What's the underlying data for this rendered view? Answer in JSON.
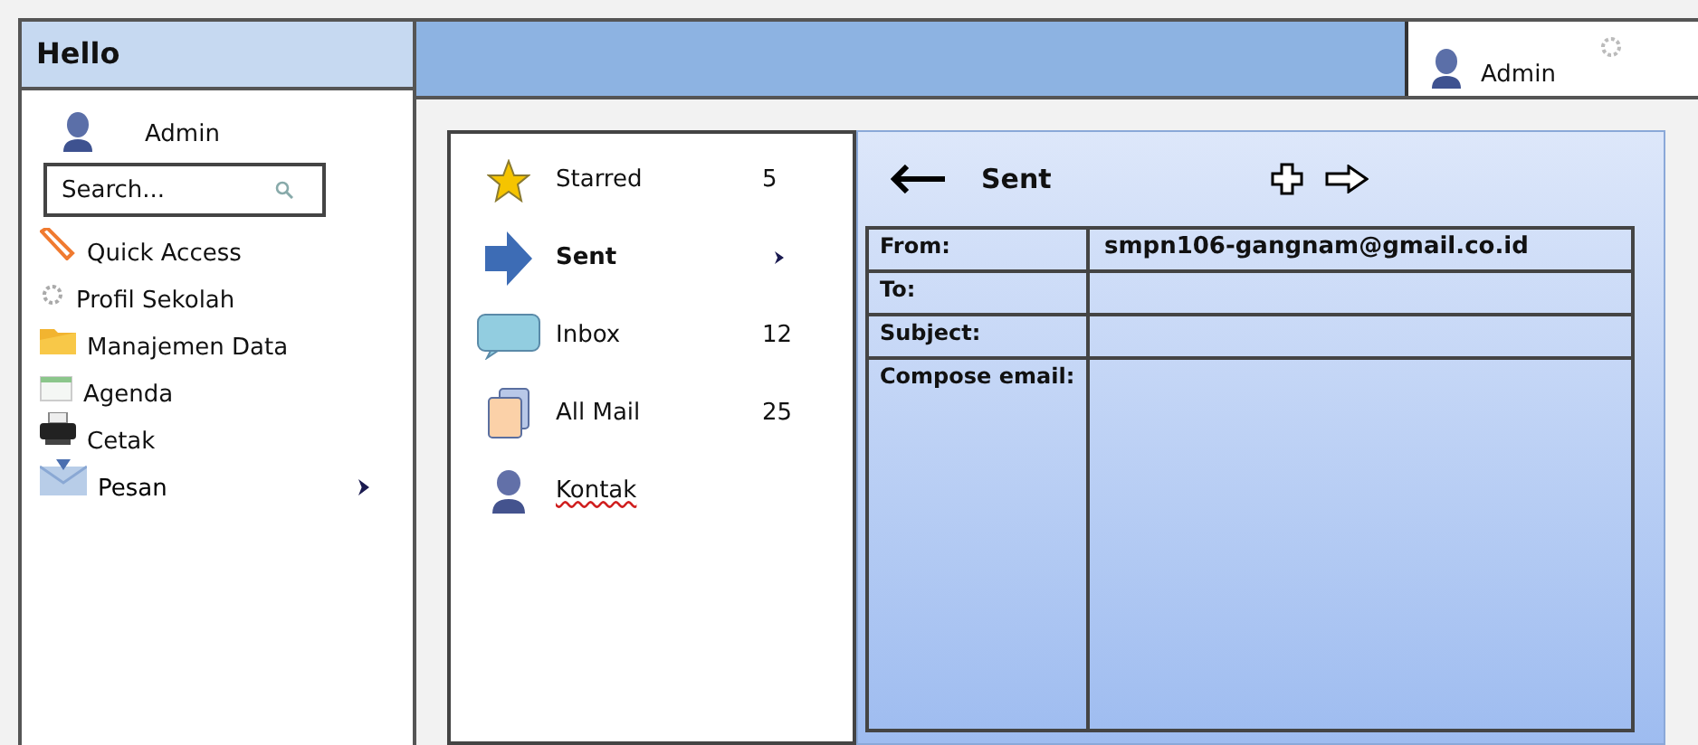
{
  "sidebar": {
    "title": "Hello",
    "user": "Admin",
    "search": {
      "placeholder": "Search..."
    },
    "items": [
      {
        "label": "Quick Access",
        "selected": false
      },
      {
        "label": "Profil Sekolah",
        "selected": false
      },
      {
        "label": "Manajemen Data",
        "selected": false
      },
      {
        "label": "Agenda",
        "selected": false
      },
      {
        "label": "Cetak",
        "selected": false
      },
      {
        "label": "Pesan",
        "selected": true
      }
    ]
  },
  "topbar": {
    "user": "Admin"
  },
  "folders": [
    {
      "label": "Starred",
      "count": "5",
      "selected": false,
      "misspelled": false
    },
    {
      "label": "Sent",
      "selected": true,
      "misspelled": false
    },
    {
      "label": "Inbox",
      "count": "12",
      "selected": false,
      "misspelled": false
    },
    {
      "label": "All Mail",
      "count": "25",
      "selected": false,
      "misspelled": false
    },
    {
      "label": "Kontak",
      "selected": false,
      "misspelled": true
    }
  ],
  "compose": {
    "title": "Sent",
    "fields": [
      {
        "label": "From:",
        "value": "smpn106-gangnam@gmail.co.id"
      },
      {
        "label": "To:"
      },
      {
        "label": "Subject:"
      },
      {
        "label": "Compose email:"
      }
    ]
  }
}
